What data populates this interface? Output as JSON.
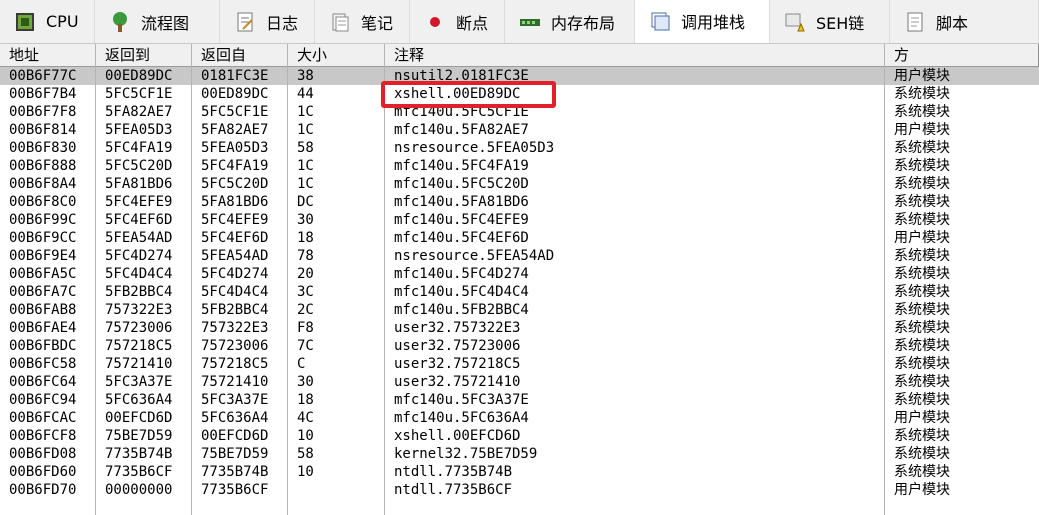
{
  "tabs": [
    {
      "label": "CPU",
      "icon": "cpu-icon",
      "active": false
    },
    {
      "label": "流程图",
      "icon": "tree-icon",
      "active": false
    },
    {
      "label": "日志",
      "icon": "log-icon",
      "active": false
    },
    {
      "label": "笔记",
      "icon": "notes-icon",
      "active": false
    },
    {
      "label": "断点",
      "icon": "breakpoint-icon",
      "active": false
    },
    {
      "label": "内存布局",
      "icon": "memory-map-icon",
      "active": false
    },
    {
      "label": "调用堆栈",
      "icon": "callstack-icon",
      "active": true
    },
    {
      "label": "SEH链",
      "icon": "seh-icon",
      "active": false
    },
    {
      "label": "脚本",
      "icon": "script-icon",
      "active": false
    }
  ],
  "columns": [
    "地址",
    "返回到",
    "返回自",
    "大小",
    "注释",
    "方"
  ],
  "rows": [
    [
      "00B6F77C",
      "00ED89DC",
      "0181FC3E",
      "38",
      "nsutil2.0181FC3E",
      "用户模块"
    ],
    [
      "00B6F7B4",
      "5FC5CF1E",
      "00ED89DC",
      "44",
      "xshell.00ED89DC",
      "系统模块"
    ],
    [
      "00B6F7F8",
      "5FA82AE7",
      "5FC5CF1E",
      "1C",
      "mfc140u.5FC5CF1E",
      "系统模块"
    ],
    [
      "00B6F814",
      "5FEA05D3",
      "5FA82AE7",
      "1C",
      "mfc140u.5FA82AE7",
      "用户模块"
    ],
    [
      "00B6F830",
      "5FC4FA19",
      "5FEA05D3",
      "58",
      "nsresource.5FEA05D3",
      "系统模块"
    ],
    [
      "00B6F888",
      "5FC5C20D",
      "5FC4FA19",
      "1C",
      "mfc140u.5FC4FA19",
      "系统模块"
    ],
    [
      "00B6F8A4",
      "5FA81BD6",
      "5FC5C20D",
      "1C",
      "mfc140u.5FC5C20D",
      "系统模块"
    ],
    [
      "00B6F8C0",
      "5FC4EFE9",
      "5FA81BD6",
      "DC",
      "mfc140u.5FA81BD6",
      "系统模块"
    ],
    [
      "00B6F99C",
      "5FC4EF6D",
      "5FC4EFE9",
      "30",
      "mfc140u.5FC4EFE9",
      "系统模块"
    ],
    [
      "00B6F9CC",
      "5FEA54AD",
      "5FC4EF6D",
      "18",
      "mfc140u.5FC4EF6D",
      "用户模块"
    ],
    [
      "00B6F9E4",
      "5FC4D274",
      "5FEA54AD",
      "78",
      "nsresource.5FEA54AD",
      "系统模块"
    ],
    [
      "00B6FA5C",
      "5FC4D4C4",
      "5FC4D274",
      "20",
      "mfc140u.5FC4D274",
      "系统模块"
    ],
    [
      "00B6FA7C",
      "5FB2BBC4",
      "5FC4D4C4",
      "3C",
      "mfc140u.5FC4D4C4",
      "系统模块"
    ],
    [
      "00B6FAB8",
      "757322E3",
      "5FB2BBC4",
      "2C",
      "mfc140u.5FB2BBC4",
      "系统模块"
    ],
    [
      "00B6FAE4",
      "75723006",
      "757322E3",
      "F8",
      "user32.757322E3",
      "系统模块"
    ],
    [
      "00B6FBDC",
      "757218C5",
      "75723006",
      "7C",
      "user32.75723006",
      "系统模块"
    ],
    [
      "00B6FC58",
      "75721410",
      "757218C5",
      "C",
      "user32.757218C5",
      "系统模块"
    ],
    [
      "00B6FC64",
      "5FC3A37E",
      "75721410",
      "30",
      "user32.75721410",
      "系统模块"
    ],
    [
      "00B6FC94",
      "5FC636A4",
      "5FC3A37E",
      "18",
      "mfc140u.5FC3A37E",
      "系统模块"
    ],
    [
      "00B6FCAC",
      "00EFCD6D",
      "5FC636A4",
      "4C",
      "mfc140u.5FC636A4",
      "用户模块"
    ],
    [
      "00B6FCF8",
      "75BE7D59",
      "00EFCD6D",
      "10",
      "xshell.00EFCD6D",
      "系统模块"
    ],
    [
      "00B6FD08",
      "7735B74B",
      "75BE7D59",
      "58",
      "kernel32.75BE7D59",
      "系统模块"
    ],
    [
      "00B6FD60",
      "7735B6CF",
      "7735B74B",
      "10",
      "ntdll.7735B74B",
      "系统模块"
    ],
    [
      "00B6FD70",
      "00000000",
      "7735B6CF",
      "",
      "ntdll.7735B6CF",
      "用户模块"
    ]
  ],
  "selected_row": 0,
  "highlighted_row": 1,
  "colors": {
    "selection": "#c8c8c8",
    "highlight_box": "#e0202a"
  }
}
